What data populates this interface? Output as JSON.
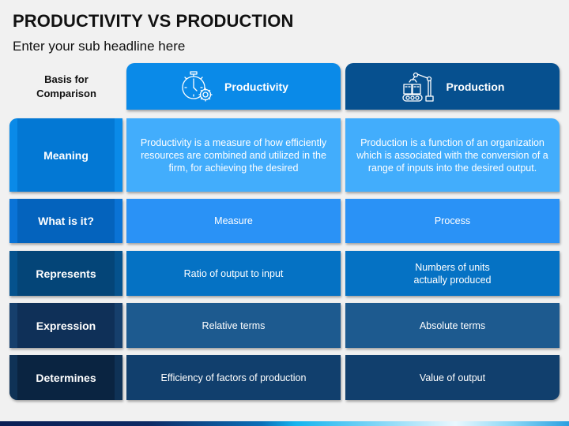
{
  "title": "PRODUCTIVITY VS PRODUCTION",
  "subtitle": "Enter your sub headline here",
  "basis_label": "Basis for Comparison",
  "columns": [
    {
      "label": "Productivity",
      "icon": "stopwatch-gear-icon",
      "color": "#0a8ae8"
    },
    {
      "label": "Production",
      "icon": "robotic-arm-conveyor-icon",
      "color": "#06508f"
    }
  ],
  "rows": [
    {
      "label": "Meaning",
      "productivity": "Productivity is a measure of how efficiently resources are combined and utilized in the firm, for achieving the desired",
      "production": "Production is a function of an organization which is associated with the conversion of a range of inputs into the desired output."
    },
    {
      "label": "What is it?",
      "productivity": "Measure",
      "production": "Process"
    },
    {
      "label": "Represents",
      "productivity": "Ratio of output to input",
      "production": "Numbers of units actually produced"
    },
    {
      "label": "Expression",
      "productivity": "Relative terms",
      "production": "Absolute terms"
    },
    {
      "label": "Determines",
      "productivity": "Efficiency of factors of production",
      "production": "Value of output"
    }
  ]
}
